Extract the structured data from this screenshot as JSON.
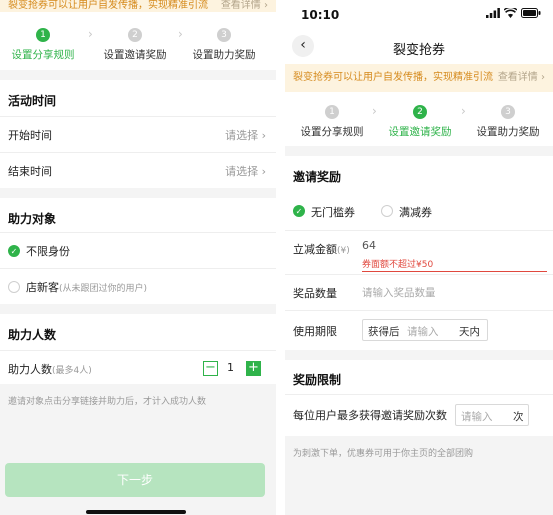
{
  "left": {
    "notice_text": "裂变抢券可以让用户自发传播，实现精准引流",
    "notice_more": "查看详情",
    "steps": [
      {
        "num": "1",
        "label": "设置分享规则"
      },
      {
        "num": "2",
        "label": "设置邀请奖励"
      },
      {
        "num": "3",
        "label": "设置助力奖励"
      }
    ],
    "activity": {
      "title": "活动时间",
      "start_label": "开始时间",
      "start_value": "请选择",
      "end_label": "结束时间",
      "end_value": "请选择"
    },
    "target": {
      "title": "助力对象",
      "option1": "不限身份",
      "option2": "店新客",
      "option2_note": "(从未跟团过你的用户)"
    },
    "count": {
      "title": "助力人数",
      "label": "助力人数",
      "label_note": "(最多4人)",
      "value": "1",
      "minus": "−",
      "plus": "+",
      "hint": "邀请对象点击分享链接并助力后，才计入成功人数"
    },
    "next_button": "下一步"
  },
  "right": {
    "time": "10:10",
    "title": "裂变抢券",
    "notice_text": "裂变抢券可以让用户自发传播，实现精准引流",
    "notice_more": "查看详情",
    "steps": [
      {
        "num": "1",
        "label": "设置分享规则"
      },
      {
        "num": "2",
        "label": "设置邀请奖励"
      },
      {
        "num": "3",
        "label": "设置助力奖励"
      }
    ],
    "reward": {
      "title": "邀请奖励",
      "type1": "无门槛券",
      "type2": "满减券",
      "amount_label": "立减金额",
      "amount_unit": "(¥)",
      "amount_value": "64",
      "amount_error": "券面额不超过¥50",
      "qty_label": "奖品数量",
      "qty_placeholder": "请输入奖品数量",
      "validity_label": "使用期限",
      "validity_prefix": "获得后",
      "validity_placeholder": "请输入",
      "validity_suffix": "天内"
    },
    "limit": {
      "title": "奖励限制",
      "label": "每位用户最多获得邀请奖励次数",
      "placeholder": "请输入",
      "unit": "次",
      "hint": "为刺激下单，优惠券可用于你主页的全部团购"
    }
  },
  "colors": {
    "accent": "#2fb34a",
    "notice_bg": "#fdf3df",
    "notice_text": "#d58a1c",
    "error": "#e0483e"
  }
}
